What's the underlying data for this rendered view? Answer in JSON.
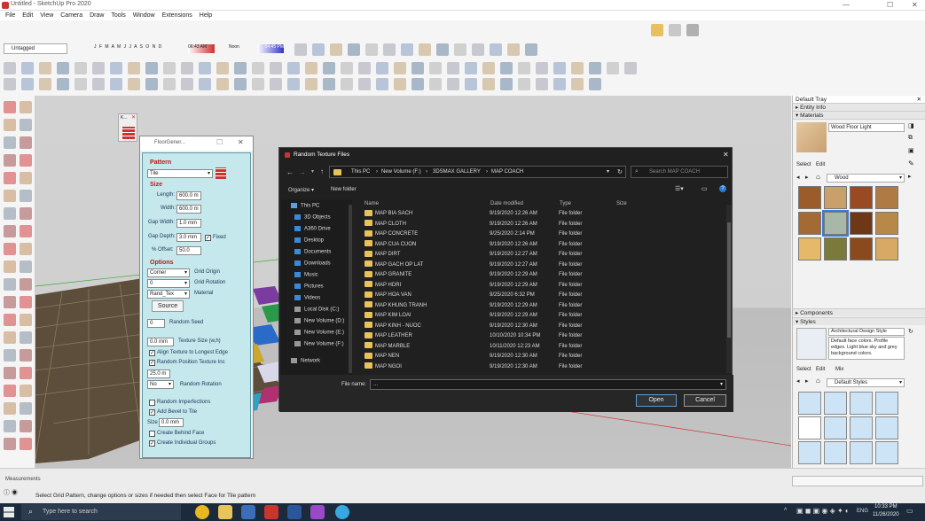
{
  "app_title": "Untitled - SketchUp Pro 2020",
  "menu": [
    "File",
    "Edit",
    "View",
    "Camera",
    "Draw",
    "Tools",
    "Window",
    "Extensions",
    "Help"
  ],
  "layer_select": "Untagged",
  "shadow_months": "J F M A M J J A S O N D",
  "shadow_time_left": "06:43 AM",
  "shadow_time_mid": "Noon",
  "shadow_time_right": "04:45 PM",
  "small_panel_title": "K...",
  "floor_gen": {
    "title": "FloorGener...",
    "pattern_label": "Pattern",
    "pattern_value": "Tile",
    "size_label": "Size",
    "length_label": "Length:",
    "length_value": "600.0 m",
    "width_label": "Width:",
    "width_value": "600.0 m",
    "gap_width_label": "Gap Width:",
    "gap_width_value": "1.0 mm",
    "gap_depth_label": "Gap Depth:",
    "gap_depth_value": "3.0 mm",
    "fixed_label": "Fixed",
    "offset_label": "% Offset:",
    "offset_value": "50.0",
    "options_label": "Options",
    "grid_origin_value": "Corner",
    "grid_origin_label": "Grid Origin",
    "grid_rotation_value": "0",
    "grid_rotation_label": "Grid Rotation",
    "material_value": "Rand_Tex",
    "material_label": "Material",
    "source_button": "Source",
    "random_seed_value": "0",
    "random_seed_label": "Random Seed",
    "texture_size_value": "0.0 mm",
    "texture_size_label": "Texture Size (w,h)",
    "align_texture_label": "Align Texture to Longest Edge",
    "random_position_label": "Random Position Texture Inc",
    "rotation_value": "25.0 m",
    "random_rotation_value": "No",
    "random_rotation_label": "Random Rotation",
    "random_imperfections_label": "Random Imperfections",
    "add_bevel_label": "Add Bevel to Tile",
    "bevel_size_label": "Size",
    "bevel_size_value": "0.0 mm",
    "behind_face_label": "Create Behind Face",
    "individual_groups_label": "Create Individual Groups"
  },
  "file_dialog": {
    "title": "Random Texture Files",
    "breadcrumb": [
      "This PC",
      "New Volume (F:)",
      "3DSMAX GALLERY",
      "MAP COACH"
    ],
    "search_placeholder": "Search MAP COACH",
    "organize_label": "Organize ▾",
    "new_folder_label": "New folder",
    "columns": [
      "Name",
      "Date modified",
      "Type",
      "Size"
    ],
    "nav_items": [
      "This PC",
      "3D Objects",
      "A360 Drive",
      "Desktop",
      "Documents",
      "Downloads",
      "Music",
      "Pictures",
      "Videos",
      "Local Disk (C:)",
      "New Volume (D:)",
      "New Volume (E:)",
      "New Volume (F:)",
      "Network"
    ],
    "rows": [
      {
        "name": "MAP BIA SACH",
        "date": "9/19/2020 12:26 AM",
        "type": "File folder"
      },
      {
        "name": "MAP CLOTH",
        "date": "9/19/2020 12:26 AM",
        "type": "File folder"
      },
      {
        "name": "MAP CONCRETE",
        "date": "9/25/2020 2:14 PM",
        "type": "File folder"
      },
      {
        "name": "MAP CUA CUON",
        "date": "9/19/2020 12:26 AM",
        "type": "File folder"
      },
      {
        "name": "MAP DIRT",
        "date": "9/19/2020 12:27 AM",
        "type": "File folder"
      },
      {
        "name": "MAP GACH OP LAT",
        "date": "9/19/2020 12:27 AM",
        "type": "File folder"
      },
      {
        "name": "MAP GRANITE",
        "date": "9/19/2020 12:29 AM",
        "type": "File folder"
      },
      {
        "name": "MAP HDRI",
        "date": "9/19/2020 12:29 AM",
        "type": "File folder"
      },
      {
        "name": "MAP HOA VAN",
        "date": "9/25/2020 6:32 PM",
        "type": "File folder"
      },
      {
        "name": "MAP KHUNG TRANH",
        "date": "9/19/2020 12:29 AM",
        "type": "File folder"
      },
      {
        "name": "MAP KIM LOAI",
        "date": "9/19/2020 12:29 AM",
        "type": "File folder"
      },
      {
        "name": "MAP KINH - NUOC",
        "date": "9/19/2020 12:30 AM",
        "type": "File folder"
      },
      {
        "name": "MAP LEATHER",
        "date": "10/10/2020 10:34 PM",
        "type": "File folder"
      },
      {
        "name": "MAP MARBLE",
        "date": "10/11/2020 12:23 AM",
        "type": "File folder"
      },
      {
        "name": "MAP NEN",
        "date": "9/19/2020 12:30 AM",
        "type": "File folder"
      },
      {
        "name": "MAP NGOI",
        "date": "9/19/2020 12:30 AM",
        "type": "File folder"
      }
    ],
    "filename_label": "File name:",
    "filename_value": "...",
    "open_button": "Open",
    "cancel_button": "Cancel"
  },
  "tray": {
    "title": "Default Tray",
    "entity_info": "Entity Info",
    "materials": "Materials",
    "material_name": "Wood Floor Light",
    "select_tab": "Select",
    "edit_tab": "Edit",
    "library": "Wood",
    "swatch_colors": [
      "#9b5b2a",
      "#c9a06a",
      "#9a4a22",
      "#b07a45",
      "#a36a34",
      "#a8b8a8",
      "#6e3818",
      "#b88848",
      "#e6b86a",
      "#7a7a3a",
      "#8a4a1e",
      "#d8a865"
    ],
    "components": "Components",
    "styles": "Styles",
    "style_name": "Architectural Design Style",
    "style_desc": "Default face colors. Profile edges. Light blue sky and grey background colors.",
    "style_select_tab": "Select",
    "style_edit_tab": "Edit",
    "style_mix_tab": "Mix",
    "style_library": "Default Styles"
  },
  "measurements_label": "Measurements",
  "status_text": "Select Grid Pattern, change options or sizes if needed then select Face for Tile pattern",
  "taskbar": {
    "search_placeholder": "Type here to search",
    "lang": "ENG",
    "time": "10:33 PM",
    "date": "11/26/2020"
  }
}
